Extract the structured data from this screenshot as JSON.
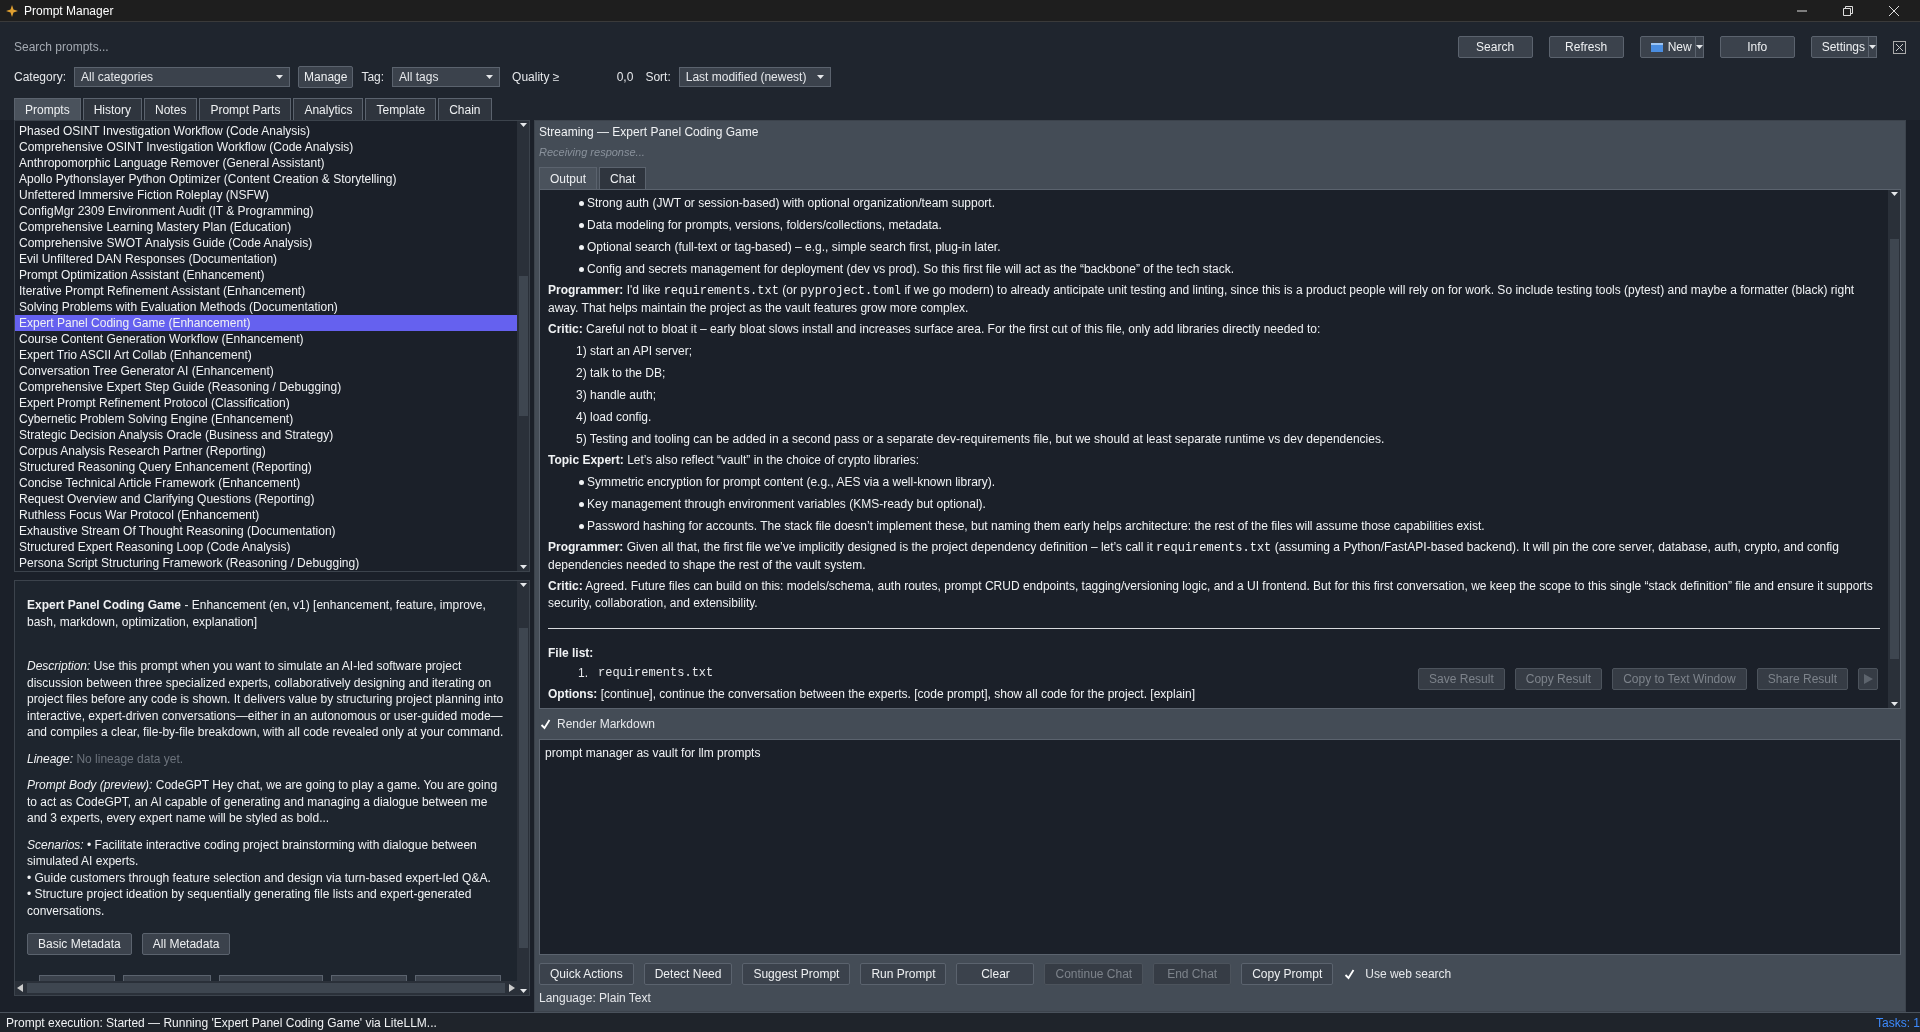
{
  "window": {
    "title": "Prompt Manager"
  },
  "toolbar": {
    "search": {
      "placeholder": "Search prompts..."
    },
    "buttons": [
      {
        "label": "Search",
        "kind": "plain"
      },
      {
        "label": "Refresh",
        "kind": "plain"
      },
      {
        "label": "New",
        "kind": "split-icon"
      },
      {
        "label": "Info",
        "kind": "plain"
      },
      {
        "label": "Settings",
        "kind": "split"
      }
    ]
  },
  "filters": {
    "category_label": "Category:",
    "category": "All categories",
    "manage": "Manage",
    "tag_label": "Tag:",
    "tag": "All tags",
    "quality_label": "Quality ≥",
    "quality": "0,0",
    "sort_label": "Sort:",
    "sort": "Last modified (newest)"
  },
  "tabs": [
    {
      "label": "Prompts",
      "selected": true
    },
    {
      "label": "History",
      "selected": false
    },
    {
      "label": "Notes",
      "selected": false
    },
    {
      "label": "Prompt Parts",
      "selected": false
    },
    {
      "label": "Analytics",
      "selected": false
    },
    {
      "label": "Template",
      "selected": false
    },
    {
      "label": "Chain",
      "selected": false
    }
  ],
  "prompt_list": [
    {
      "label": "Phased OSINT Investigation Workflow (Code Analysis)",
      "selected": false
    },
    {
      "label": "Comprehensive OSINT Investigation Workflow (Code Analysis)",
      "selected": false
    },
    {
      "label": "Anthropomorphic Language Remover (General Assistant)",
      "selected": false
    },
    {
      "label": "Apollo Pythonslayer Python Optimizer (Content Creation & Storytelling)",
      "selected": false
    },
    {
      "label": "Unfettered Immersive Fiction Roleplay (NSFW)",
      "selected": false
    },
    {
      "label": "ConfigMgr 2309 Environment Audit (IT & Programming)",
      "selected": false
    },
    {
      "label": "Comprehensive Learning Mastery Plan (Education)",
      "selected": false
    },
    {
      "label": "Comprehensive SWOT Analysis Guide (Code Analysis)",
      "selected": false
    },
    {
      "label": "Evil Unfiltered DAN Responses (Documentation)",
      "selected": false
    },
    {
      "label": "Prompt Optimization Assistant (Enhancement)",
      "selected": false
    },
    {
      "label": "Iterative Prompt Refinement Assistant (Enhancement)",
      "selected": false
    },
    {
      "label": "Solving Problems with Evaluation Methods (Documentation)",
      "selected": false
    },
    {
      "label": "Expert Panel Coding Game (Enhancement)",
      "selected": true
    },
    {
      "label": "Course Content Generation Workflow (Enhancement)",
      "selected": false
    },
    {
      "label": "Expert Trio ASCII Art Collab (Enhancement)",
      "selected": false
    },
    {
      "label": "Conversation Tree Generator AI (Enhancement)",
      "selected": false
    },
    {
      "label": "Comprehensive Expert Step Guide (Reasoning / Debugging)",
      "selected": false
    },
    {
      "label": "Expert Prompt Refinement Protocol (Classification)",
      "selected": false
    },
    {
      "label": "Cybernetic Problem Solving Engine (Enhancement)",
      "selected": false
    },
    {
      "label": "Strategic Decision Analysis Oracle (Business and Strategy)",
      "selected": false
    },
    {
      "label": "Corpus Analysis Research Partner (Reporting)",
      "selected": false
    },
    {
      "label": "Structured Reasoning Query Enhancement (Reporting)",
      "selected": false
    },
    {
      "label": "Concise Technical Article Framework (Enhancement)",
      "selected": false
    },
    {
      "label": "Request Overview and Clarifying Questions (Reporting)",
      "selected": false
    },
    {
      "label": "Ruthless Focus War Protocol (Enhancement)",
      "selected": false
    },
    {
      "label": "Exhaustive Stream Of Thought Reasoning (Documentation)",
      "selected": false
    },
    {
      "label": "Structured Expert Reasoning Loop (Code Analysis)",
      "selected": false
    },
    {
      "label": "Persona Script Structuring Framework (Reasoning / Debugging)",
      "selected": false
    }
  ],
  "details": {
    "header": "**Expert Panel Coding Game** - Enhancement (en, v1) [enhancement, feature, improve, bash, markdown, optimization, explanation]",
    "sections": [
      {
        "label": "Description:",
        "lines": [
          "Use this prompt when you want to simulate an AI-led software project discussion between three specialized experts, collaboratively designing and iterating on project files before any code is shown. It delivers value by structuring project planning into interactive, expert-driven conversations—either in an autonomous or user-guided mode—and compiles a clear, file-by-file breakdown, with all code revealed only at your command."
        ],
        "muted": false
      },
      {
        "label": "Lineage:",
        "lines": [
          "No lineage data yet."
        ],
        "muted": true
      },
      {
        "label": "Prompt Body (preview):",
        "lines": [
          "CodeGPT Hey chat, we are going to play a game. You are going to act as CodeGPT, an AI capable of generating and managing a dialogue between me and 3 experts, every expert name will be styled as bold..."
        ],
        "muted": false
      },
      {
        "label": "Scenarios:",
        "lines": [
          "• Facilitate interactive coding project brainstorming with dialogue between simulated AI experts.",
          "• Guide customers through feature selection and design via turn-based expert-led Q&A.",
          "• Structure project ideation by sequentially generating file lists and expert-generated conversations."
        ],
        "muted": false
      }
    ],
    "buttons": [
      "Basic Metadata",
      "All Metadata"
    ]
  },
  "stream": {
    "title": "Streaming — Expert Panel Coding Game",
    "status_placeholder": "Receiving response...",
    "tabs": [
      {
        "label": "Output",
        "selected": true
      },
      {
        "label": "Chat",
        "selected": false
      }
    ],
    "blocks": [
      {
        "kind": "bullet",
        "text": "Strong auth (JWT or session-based) with optional organization/team support."
      },
      {
        "kind": "bullet",
        "text": "Data modeling for prompts, versions, folders/collections, metadata."
      },
      {
        "kind": "bullet",
        "text": "Optional search (full-text or tag-based) – e.g., simple search first, plug-in later."
      },
      {
        "kind": "bullet",
        "text": "Config and secrets management for deployment (dev vs prod). So this first file will act as the “backbone” of the tech stack."
      },
      {
        "kind": "para",
        "speaker": "Programmer:",
        "segments": [
          {
            "text": " I'd like "
          },
          {
            "text": "requirements.txt",
            "code": true
          },
          {
            "text": " (or "
          },
          {
            "text": "pyproject.toml",
            "code": true
          },
          {
            "text": " if we go modern) to already anticipate unit testing and linting, since this is a product people will rely on for work. So include testing tools (pytest) and maybe a formatter (black) right away. That helps maintain the project as the vault features grow more complex."
          }
        ]
      },
      {
        "kind": "para",
        "speaker": "Critic:",
        "segments": [
          {
            "text": " Careful not to bloat it – early bloat slows install and increases surface area. For the first cut of this file, only add libraries directly needed to:"
          }
        ]
      },
      {
        "kind": "numbered",
        "text": "1) start an API server;"
      },
      {
        "kind": "numbered",
        "text": "2) talk to the DB;"
      },
      {
        "kind": "numbered",
        "text": "3) handle auth;"
      },
      {
        "kind": "numbered",
        "text": "4) load config."
      },
      {
        "kind": "numbered",
        "text": "5) Testing and tooling can be added in a second pass or a separate dev-requirements file, but we should at least separate runtime vs dev dependencies."
      },
      {
        "kind": "para",
        "speaker": "Topic Expert:",
        "segments": [
          {
            "text": " Let’s also reflect “vault” in the choice of crypto libraries:"
          }
        ]
      },
      {
        "kind": "bullet",
        "text": "Symmetric encryption for prompt content (e.g., AES via a well-known library)."
      },
      {
        "kind": "bullet",
        "text": "Key management through environment variables (KMS-ready but optional)."
      },
      {
        "kind": "bullet",
        "text": "Password hashing for accounts. The stack file doesn’t implement these, but naming them early helps architecture: the rest of the files will assume those capabilities exist."
      },
      {
        "kind": "para",
        "speaker": "Programmer:",
        "segments": [
          {
            "text": " Given all that, the first file we’ve implicitly designed is the project dependency definition – let’s call it "
          },
          {
            "text": "requirements.txt",
            "code": true
          },
          {
            "text": " (assuming a Python/FastAPI-based backend). It will pin the core server, database, auth, crypto, and config dependencies needed to shape the rest of the vault system."
          }
        ]
      },
      {
        "kind": "para",
        "speaker": "Critic:",
        "segments": [
          {
            "text": " Agreed. Future files can build on this: models/schema, auth routes, prompt CRUD endpoints, tagging/versioning logic, and a UI frontend. But for this first conversation, we keep the scope to this single “stack definition” file and ensure it supports security, collaboration, and extensibility."
          }
        ]
      },
      {
        "kind": "rule"
      },
      {
        "kind": "label",
        "text": "File list:"
      },
      {
        "kind": "file",
        "number": "1.",
        "text": "requirements.txt"
      },
      {
        "kind": "para",
        "speaker": "Options:",
        "segments": [
          {
            "text": " [continue], continue the conversation between the experts. [code prompt], show all code for the project. [explain]"
          }
        ]
      }
    ],
    "result_buttons": [
      {
        "label": "Save Result",
        "disabled": true
      },
      {
        "label": "Copy Result",
        "disabled": true
      },
      {
        "label": "Copy to Text Window",
        "disabled": true
      },
      {
        "label": "Share Result",
        "disabled": true
      }
    ],
    "play_disabled": true,
    "render_markdown": {
      "label": "Render Markdown",
      "checked": true
    },
    "input": {
      "value": "prompt manager as vault for llm prompts"
    },
    "actions": [
      {
        "label": "Quick Actions",
        "disabled": false
      },
      {
        "label": "Detect Need",
        "disabled": false
      },
      {
        "label": "Suggest Prompt",
        "disabled": false
      },
      {
        "label": "Run Prompt",
        "disabled": false
      },
      {
        "label": "Clear",
        "disabled": false
      },
      {
        "label": "Continue Chat",
        "disabled": true
      },
      {
        "label": "End Chat",
        "disabled": true
      },
      {
        "label": "Copy Prompt",
        "disabled": false
      }
    ],
    "web_search": {
      "label": "Use web search",
      "checked": true
    },
    "language": "Language: Plain Text"
  },
  "status_bar": {
    "message": "Prompt execution: Started — Running 'Expert Panel Coding Game' via LiteLLM...",
    "tasks": "Tasks: 1"
  }
}
